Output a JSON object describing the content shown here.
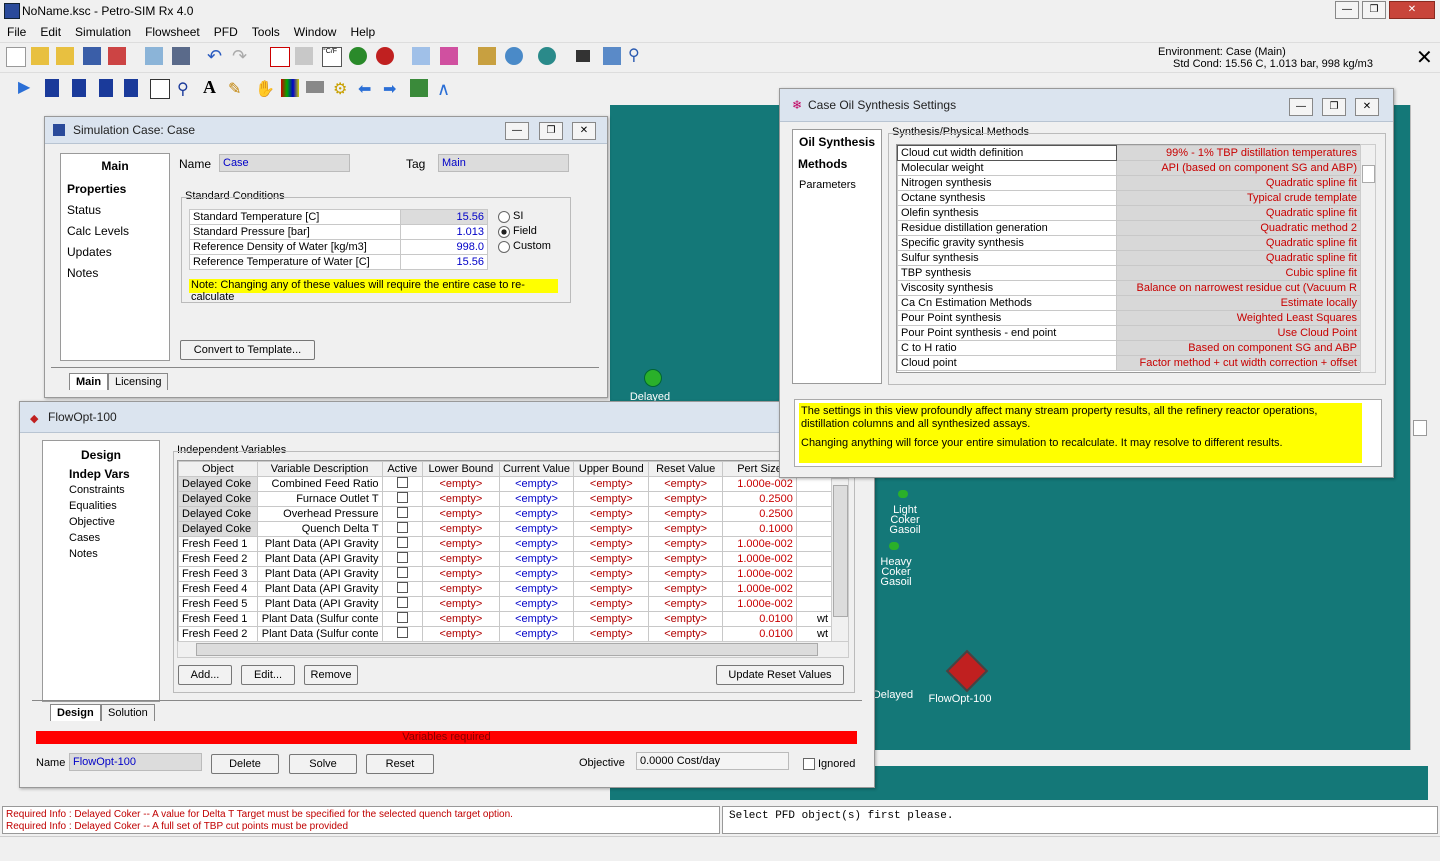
{
  "app": {
    "title": "NoName.ksc - Petro-SIM Rx 4.0",
    "env_line1": "Environment: Case (Main)",
    "env_line2": "Std Cond: 15.56 C, 1.013 bar, 998 kg/m3"
  },
  "menu": [
    "File",
    "Edit",
    "Simulation",
    "Flowsheet",
    "PFD",
    "Tools",
    "Window",
    "Help"
  ],
  "sim_case": {
    "title": "Simulation Case: Case",
    "nav": [
      "Main",
      "Properties",
      "Status",
      "Calc Levels",
      "Updates",
      "Notes"
    ],
    "name_label": "Name",
    "name_value": "Case",
    "tag_label": "Tag",
    "tag_value": "Main",
    "std_cond_label": "Standard Conditions",
    "rows": [
      {
        "label": "Standard Temperature [C]",
        "value": "15.56"
      },
      {
        "label": "Standard Pressure [bar]",
        "value": "1.013"
      },
      {
        "label": "Reference Density of Water [kg/m3]",
        "value": "998.0"
      },
      {
        "label": "Reference Temperature of Water [C]",
        "value": "15.56"
      }
    ],
    "radios": [
      "SI",
      "Field",
      "Custom"
    ],
    "note": "Note: Changing any of these values will require the entire case to re-calculate",
    "convert_btn": "Convert to Template...",
    "tabs": [
      "Main",
      "Licensing"
    ]
  },
  "flowopt": {
    "title": "FlowOpt-100",
    "nav_header": "Design",
    "nav": [
      "Indep Vars",
      "Constraints",
      "Equalities",
      "Objective",
      "Cases",
      "Notes"
    ],
    "group_label": "Independent Variables",
    "headers": [
      "Object",
      "Variable Description",
      "Active",
      "Lower Bound",
      "Current Value",
      "Upper Bound",
      "Reset Value",
      "Pert Size"
    ],
    "rows": [
      {
        "obj": "Delayed Coke",
        "desc": "Combined Feed Ratio",
        "lb": "<empty>",
        "cv": "<empty>",
        "ub": "<empty>",
        "rv": "<empty>",
        "ps": "1.000e-002",
        "x": ""
      },
      {
        "obj": "Delayed Coke",
        "desc": "Furnace Outlet T",
        "lb": "<empty>",
        "cv": "<empty>",
        "ub": "<empty>",
        "rv": "<empty>",
        "ps": "0.2500",
        "x": ""
      },
      {
        "obj": "Delayed Coke",
        "desc": "Overhead Pressure",
        "lb": "<empty>",
        "cv": "<empty>",
        "ub": "<empty>",
        "rv": "<empty>",
        "ps": "0.2500",
        "x": ""
      },
      {
        "obj": "Delayed Coke",
        "desc": "Quench Delta T",
        "lb": "<empty>",
        "cv": "<empty>",
        "ub": "<empty>",
        "rv": "<empty>",
        "ps": "0.1000",
        "x": ""
      },
      {
        "obj": "Fresh Feed 1",
        "desc": "Plant Data (API Gravity",
        "lb": "<empty>",
        "cv": "<empty>",
        "ub": "<empty>",
        "rv": "<empty>",
        "ps": "1.000e-002",
        "x": ""
      },
      {
        "obj": "Fresh Feed 2",
        "desc": "Plant Data (API Gravity",
        "lb": "<empty>",
        "cv": "<empty>",
        "ub": "<empty>",
        "rv": "<empty>",
        "ps": "1.000e-002",
        "x": ""
      },
      {
        "obj": "Fresh Feed 3",
        "desc": "Plant Data (API Gravity",
        "lb": "<empty>",
        "cv": "<empty>",
        "ub": "<empty>",
        "rv": "<empty>",
        "ps": "1.000e-002",
        "x": ""
      },
      {
        "obj": "Fresh Feed 4",
        "desc": "Plant Data (API Gravity",
        "lb": "<empty>",
        "cv": "<empty>",
        "ub": "<empty>",
        "rv": "<empty>",
        "ps": "1.000e-002",
        "x": ""
      },
      {
        "obj": "Fresh Feed 5",
        "desc": "Plant Data (API Gravity",
        "lb": "<empty>",
        "cv": "<empty>",
        "ub": "<empty>",
        "rv": "<empty>",
        "ps": "1.000e-002",
        "x": ""
      },
      {
        "obj": "Fresh Feed 1",
        "desc": "Plant Data (Sulfur conte",
        "lb": "<empty>",
        "cv": "<empty>",
        "ub": "<empty>",
        "rv": "<empty>",
        "ps": "0.0100",
        "x": "wt"
      },
      {
        "obj": "Fresh Feed 2",
        "desc": "Plant Data (Sulfur conte",
        "lb": "<empty>",
        "cv": "<empty>",
        "ub": "<empty>",
        "rv": "<empty>",
        "ps": "0.0100",
        "x": "wt"
      }
    ],
    "add_btn": "Add...",
    "edit_btn": "Edit...",
    "remove_btn": "Remove",
    "update_btn": "Update Reset Values",
    "tabs": [
      "Design",
      "Solution"
    ],
    "status": "Variables required",
    "name_label": "Name",
    "name_value": "FlowOpt-100",
    "delete_btn": "Delete",
    "solve_btn": "Solve",
    "reset_btn": "Reset",
    "objective_label": "Objective",
    "objective_value": "0.0000 Cost/day",
    "ignored_label": "Ignored"
  },
  "oil": {
    "title": "Case Oil Synthesis Settings",
    "nav": [
      "Oil Synthesis",
      "Methods",
      "Parameters"
    ],
    "group_label": "Synthesis/Physical Methods",
    "rows": [
      {
        "k": "Cloud cut width definition",
        "v": "99% - 1% TBP distillation temperatures"
      },
      {
        "k": "Molecular weight",
        "v": "API (based on component SG and ABP)"
      },
      {
        "k": "Nitrogen synthesis",
        "v": "Quadratic spline fit"
      },
      {
        "k": "Octane synthesis",
        "v": "Typical crude template"
      },
      {
        "k": "Olefin synthesis",
        "v": "Quadratic spline fit"
      },
      {
        "k": "Residue distillation generation",
        "v": "Quadratic method 2"
      },
      {
        "k": "Specific gravity synthesis",
        "v": "Quadratic spline fit"
      },
      {
        "k": "Sulfur synthesis",
        "v": "Quadratic spline fit"
      },
      {
        "k": "TBP synthesis",
        "v": "Cubic spline fit"
      },
      {
        "k": "Viscosity synthesis",
        "v": "Balance on narrowest residue cut (Vacuum R"
      },
      {
        "k": "Ca Cn Estimation Methods",
        "v": "Estimate locally"
      },
      {
        "k": "Pour Point synthesis",
        "v": "Weighted Least Squares"
      },
      {
        "k": "Pour Point synthesis - end point",
        "v": "Use Cloud Point"
      },
      {
        "k": "C to H ratio",
        "v": "Based on component SG and ABP"
      },
      {
        "k": "Cloud point",
        "v": "Factor method + cut width correction + offset"
      }
    ],
    "note1": "The settings in this view profoundly affect many stream property results, all the refinery reactor operations, distillation columns and all synthesized assays.",
    "note2": "Changing anything will force your entire simulation to recalculate.  It may resolve to different results."
  },
  "pfd": {
    "labels": [
      "Delayed",
      "Light Coker Gasoil",
      "Heavy Coker Gasoil",
      "Delayed",
      "FlowOpt-100"
    ]
  },
  "messages": {
    "line1": "Required Info  : Delayed Coker -- A value for Delta T Target must be specified for the selected quench target option.",
    "line2": "Required Info  : Delayed Coker -- A full set of TBP cut points must be provided",
    "right": "Select PFD object(s) first please."
  },
  "colors": {
    "pfd": "#147878",
    "status_red": "#ff0000",
    "note_yellow": "#ffff00"
  }
}
